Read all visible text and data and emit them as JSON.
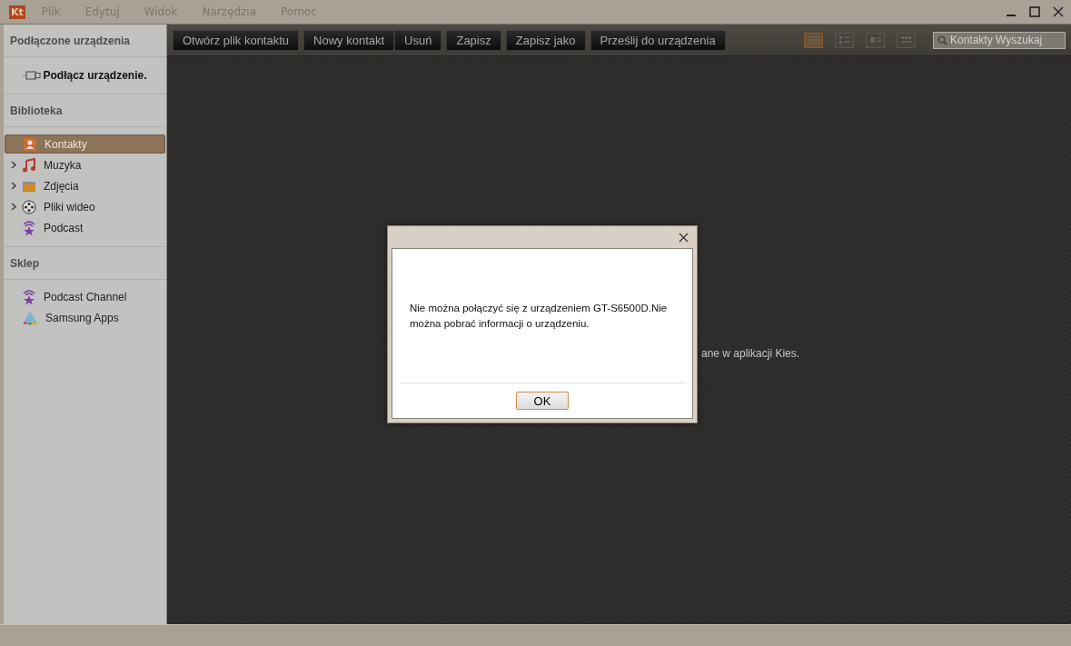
{
  "window": {
    "logo": "Kt",
    "menu": [
      "Plik",
      "Edytuj",
      "Widok",
      "Narzędzia",
      "Pomoc"
    ]
  },
  "toolbar": {
    "groups": [
      [
        "Otwórz plik kontaktu"
      ],
      [
        "Nowy kontakt",
        "Usuń"
      ],
      [
        "Zapisz"
      ],
      [
        "Zapisz jako"
      ],
      [
        "Prześlij do urządzenia"
      ]
    ],
    "view_modes": [
      {
        "kind": "list",
        "selected": true
      },
      {
        "kind": "detail",
        "selected": false
      },
      {
        "kind": "card",
        "selected": false
      },
      {
        "kind": "grid",
        "selected": false
      }
    ],
    "search": {
      "placeholder": "Kontakty Wyszukaj"
    }
  },
  "sidebar": {
    "device_heading": "Podłączone urządzenia",
    "connect_label": "Podłącz urządzenie.",
    "sections": [
      {
        "heading": "Biblioteka",
        "items": [
          {
            "label": "Kontakty",
            "kind": "contacts",
            "selected": true
          },
          {
            "label": "Muzyka",
            "kind": "music",
            "expandable": true,
            "selected": false
          },
          {
            "label": "Zdjęcia",
            "kind": "photos",
            "expandable": true,
            "selected": false
          },
          {
            "label": "Pliki wideo",
            "kind": "video",
            "expandable": true,
            "selected": false
          },
          {
            "label": "Podcast",
            "kind": "podcast",
            "selected": false
          }
        ]
      },
      {
        "heading": "Sklep",
        "items": [
          {
            "label": "Podcast Channel",
            "kind": "podcast",
            "selected": false
          },
          {
            "label": "Samsung Apps",
            "kind": "apps",
            "selected": false
          }
        ]
      }
    ]
  },
  "background_text": "ane w aplikacji Kies.",
  "dialog": {
    "message": "Nie można połączyć się z urządzeniem GT-S6500D.Nie można pobrać informacji o urządzeniu.",
    "button": "OK"
  }
}
